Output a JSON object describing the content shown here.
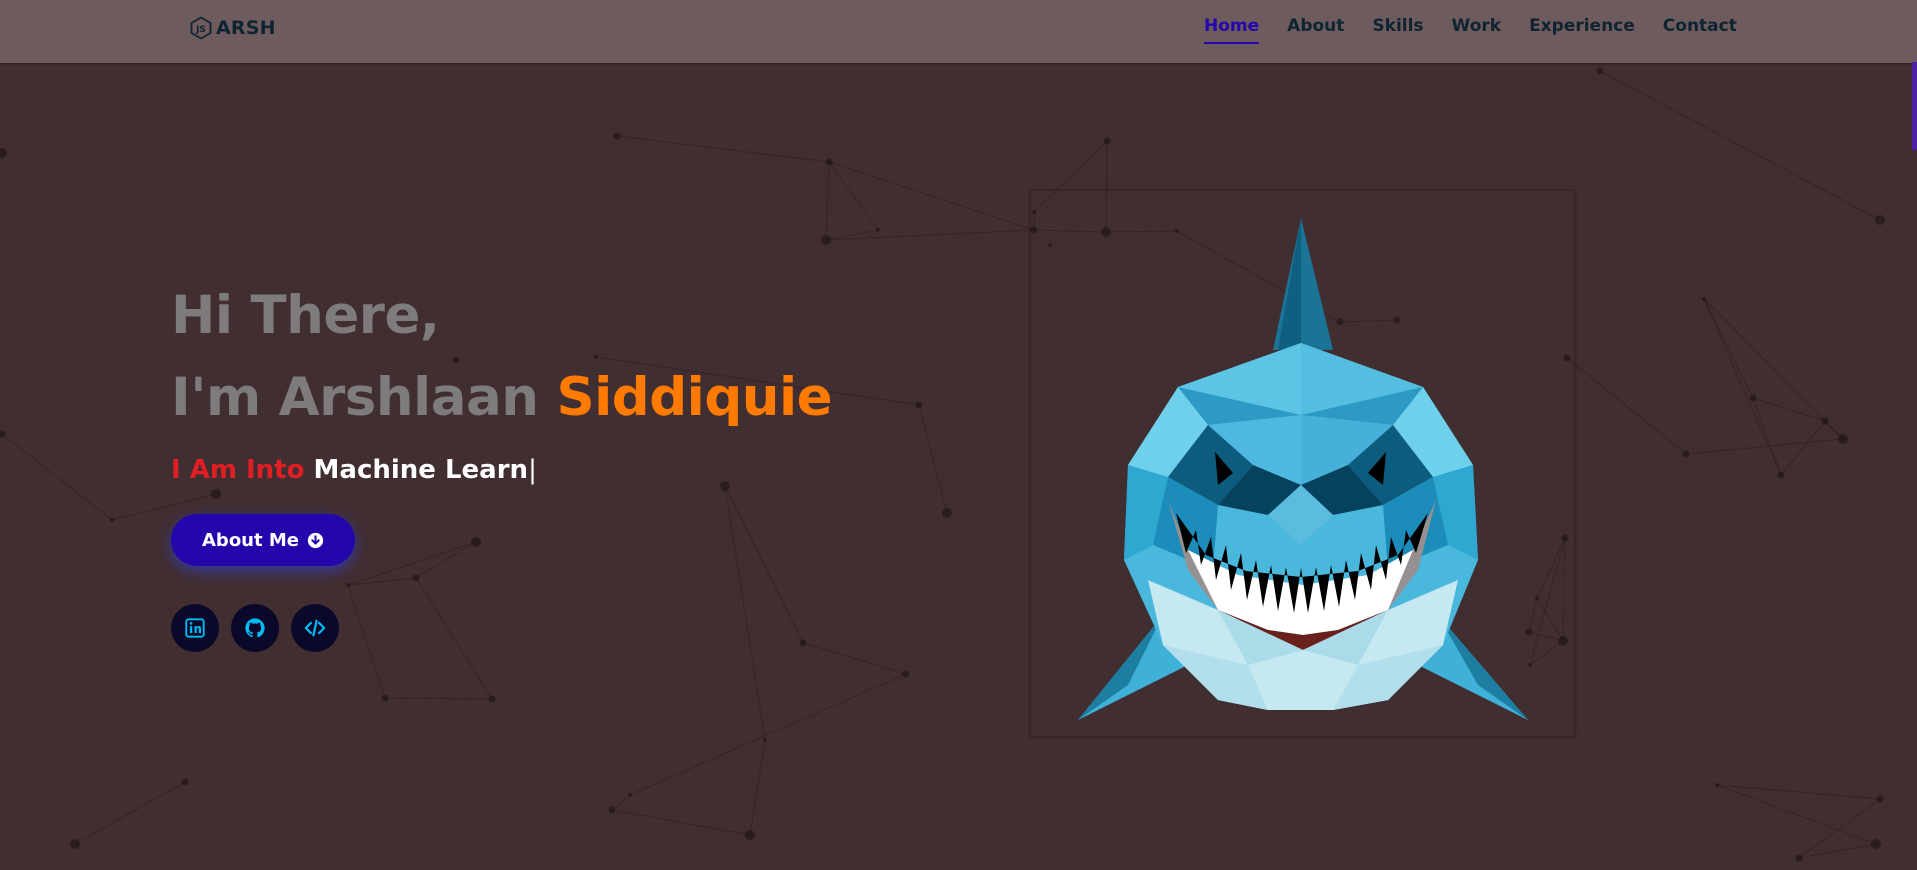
{
  "nav": {
    "logo_text": "ARSH",
    "logo_icon": "hexagon-js-icon",
    "links": [
      {
        "label": "Home",
        "active": true
      },
      {
        "label": "About"
      },
      {
        "label": "Skills"
      },
      {
        "label": "Work"
      },
      {
        "label": "Experience"
      },
      {
        "label": "Contact"
      }
    ]
  },
  "hero": {
    "greeting": "Hi There,",
    "name_prefix": "I'm Arshlaan ",
    "name_highlight": "Siddiquie",
    "typing_prefix": "I Am Into ",
    "typing_text": "Machine Learn",
    "cursor": "|",
    "button_label": "About Me",
    "button_icon": "arrow-circle-down-icon",
    "socials": [
      {
        "name": "linkedin",
        "icon": "linkedin-icon"
      },
      {
        "name": "github",
        "icon": "github-icon"
      },
      {
        "name": "code",
        "icon": "code-icon"
      }
    ]
  },
  "image": {
    "subject": "low-poly shark illustration"
  },
  "colors": {
    "background": "#412e31",
    "navbar": "#6d5b5d",
    "nav_text": "#0e2431",
    "accent": "#2506ad",
    "highlight": "#ff7a00",
    "typing_prefix": "#e01e24",
    "heading_gray": "#7d7b7b",
    "social_bg": "#0b0929",
    "social_icon": "#00bcf5"
  }
}
